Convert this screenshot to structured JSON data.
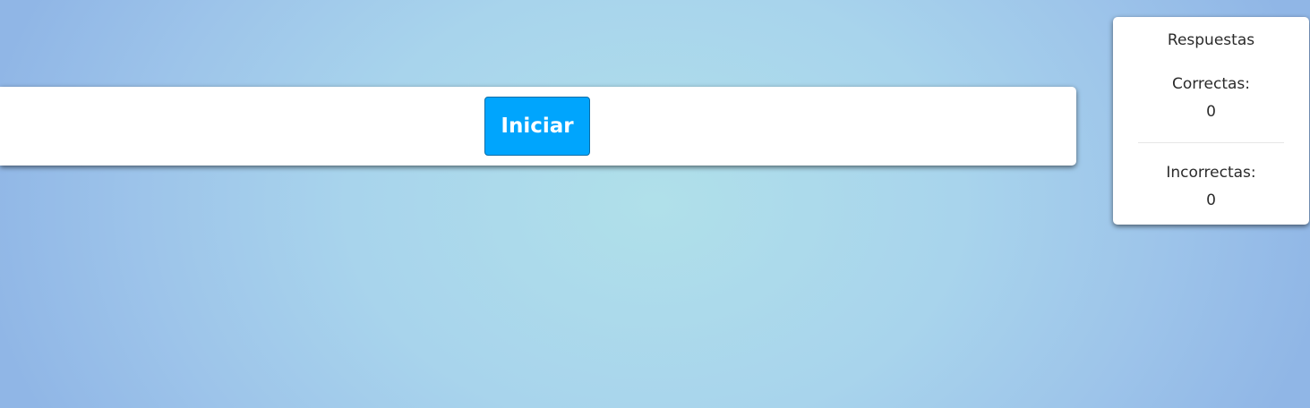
{
  "main": {
    "start_label": "Iniciar"
  },
  "score": {
    "title": "Respuestas",
    "correct_label": "Correctas:",
    "correct_value": "0",
    "incorrect_label": "Incorrectas:",
    "incorrect_value": "0"
  },
  "colors": {
    "button": "#00a5fd",
    "background_center": "#b0e0ea",
    "background_edge": "#90b6e6"
  }
}
